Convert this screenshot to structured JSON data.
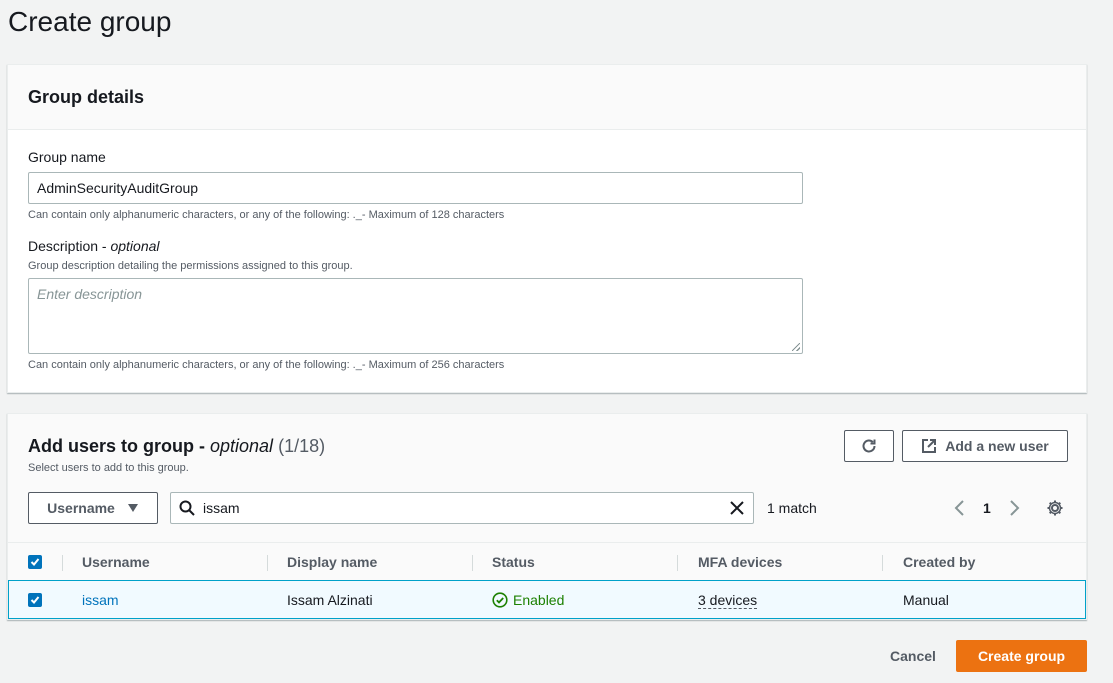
{
  "page": {
    "title": "Create group"
  },
  "group_details": {
    "heading": "Group details",
    "name_label": "Group name",
    "name_value": "AdminSecurityAuditGroup",
    "name_hint": "Can contain only alphanumeric characters, or any of the following: ._- Maximum of 128 characters",
    "description_label": "Description - ",
    "description_optional": "optional",
    "description_subtext": "Group description detailing the permissions assigned to this group.",
    "description_placeholder": "Enter description",
    "description_hint": "Can contain only alphanumeric characters, or any of the following: ._- Maximum of 256 characters"
  },
  "add_users": {
    "heading": "Add users to group - ",
    "heading_optional": "optional",
    "count": "(1/18)",
    "subtext": "Select users to add to this group.",
    "add_user_label": "Add a new user",
    "filter_property": "Username",
    "search_value": "issam",
    "match_text": "1 match",
    "page_number": "1",
    "columns": [
      "Username",
      "Display name",
      "Status",
      "MFA devices",
      "Created by"
    ],
    "rows": [
      {
        "username": "issam",
        "display_name": "Issam Alzinati",
        "status": "Enabled",
        "mfa_devices": "3 devices",
        "created_by": "Manual",
        "selected": true
      }
    ]
  },
  "footer": {
    "cancel_label": "Cancel",
    "create_label": "Create group"
  },
  "colors": {
    "accent": "#ec7211",
    "link": "#0073bb",
    "success": "#1d8102",
    "selected_row": "#f1faff"
  },
  "icons": [
    "refresh-icon",
    "external-link-icon",
    "caret-down-icon",
    "search-icon",
    "clear-icon",
    "chevron-left-icon",
    "chevron-right-icon",
    "gear-icon",
    "check-icon",
    "status-check-icon"
  ]
}
